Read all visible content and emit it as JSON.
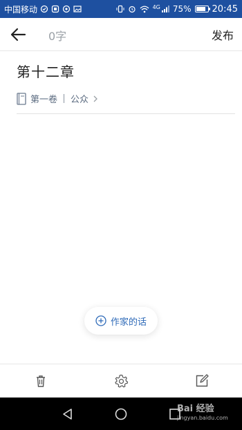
{
  "status_bar": {
    "carrier": "中国移动",
    "network": "4G",
    "battery_percent": "75%",
    "battery_level": 0.75,
    "time": "20:45",
    "background": "#1e50a0"
  },
  "top_nav": {
    "back_icon": "arrow-left-icon",
    "word_count": "0字",
    "publish_label": "发布"
  },
  "chapter": {
    "title": "第十二章",
    "volume": "第一卷",
    "category": "公众"
  },
  "author_note": {
    "label": "作家的话",
    "icon": "plus-circle-icon",
    "accent": "#2e6ab8"
  },
  "toolbar": {
    "items": [
      "trash-icon",
      "gear-icon",
      "edit-icon"
    ]
  },
  "system_nav": {
    "items": [
      "back-triangle-icon",
      "home-circle-icon",
      "recent-square-icon"
    ]
  },
  "watermark": {
    "line1": "Bai 经验",
    "line2": "jingyan.baidu.com"
  }
}
